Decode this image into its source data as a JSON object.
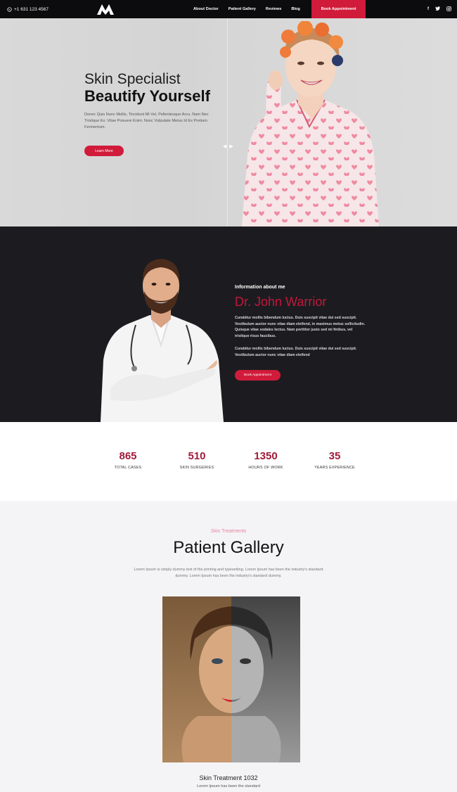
{
  "nav": {
    "phone": "+1 631 123 4567",
    "menu": [
      "About Doctor",
      "Patient Gallery",
      "Reviews",
      "Blog"
    ],
    "book_label": "Book Appointment",
    "social": [
      "f",
      "t",
      "ig"
    ]
  },
  "hero": {
    "subtitle": "Skin Specialist",
    "title": "Beautify Yourself",
    "text": "Donec Quis Nunc Mollis, Tincidunt Mi Vel, Pellentesque Arcu. Nam Nec Tristique Ex. Vitae Posuere Enim. Nunc Vulputate Metus Id Ex Pretium Fermentum.",
    "button": "Learn More"
  },
  "doctor": {
    "label": "Information about me",
    "name": "Dr. John Warrior",
    "p1": "Curabitur mollis bibendum luctus. Duis suscipit vitae dui sed suscipit. Vestibulum auctor nunc vitae diam eleifend, in maximus metus sollicitudin. Quisque vitae sodales lectus. Nam porttitor justo sed mi finibus, vel tristique risus faucibus.",
    "p2": "Curabitur mollis bibendum luctus. Duis suscipit vitae dui sed suscipit. Vestibulum auctor nunc vitae diam eleifend",
    "button": "Book Appointment"
  },
  "stats": [
    {
      "num": "865",
      "label": "TOTAL CASES"
    },
    {
      "num": "510",
      "label": "SKIN SURGERIES"
    },
    {
      "num": "1350",
      "label": "HOURS OF WORK"
    },
    {
      "num": "35",
      "label": "YEARS EXPERIENCE"
    }
  ],
  "gallery": {
    "tag": "Skin Treatments",
    "title": "Patient Gallery",
    "text": "Lorem Ipsum is simply dummy text of the printing and typesetting. Lorem Ipsum has been the industry's standard dummy. Lorem Ipsum has been the industry's standard dummy.",
    "caption": "Skin Treatment 1032",
    "subcaption": "Lorem Ipsum has been the standard"
  },
  "colors": {
    "accent": "#d11b3a",
    "dark": "#1c1c20",
    "stat": "#a01a3a"
  }
}
